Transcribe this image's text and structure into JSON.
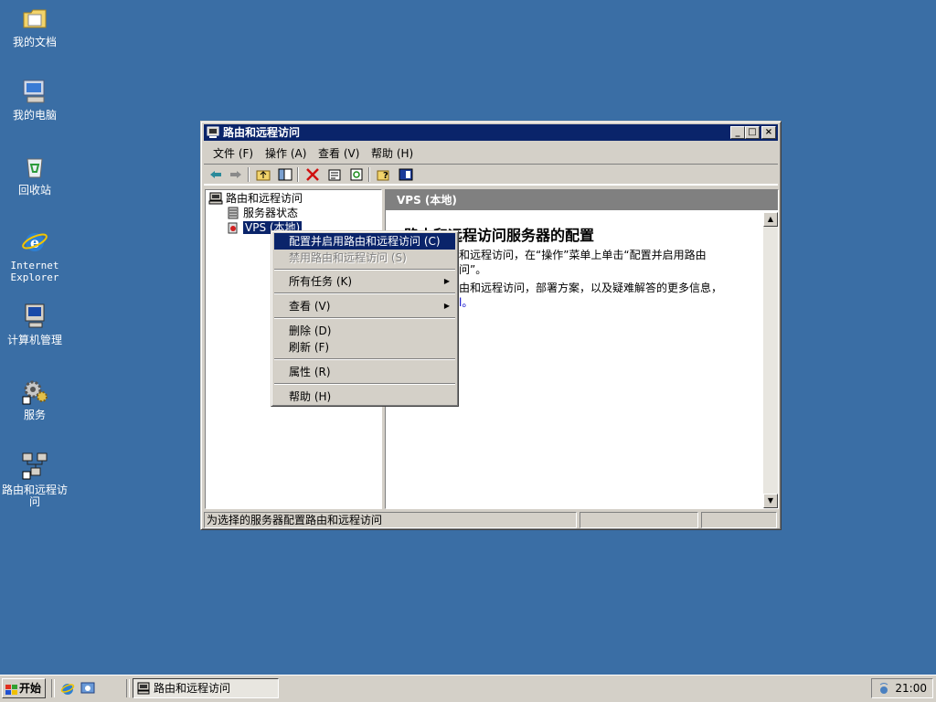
{
  "desktop": {
    "icons": [
      {
        "label": "我的文档"
      },
      {
        "label": "我的电脑"
      },
      {
        "label": "回收站"
      },
      {
        "label": "Internet Explorer"
      },
      {
        "label": "计算机管理"
      },
      {
        "label": "服务"
      },
      {
        "label": "路由和远程访问"
      }
    ]
  },
  "window": {
    "title": "路由和远程访问",
    "menu": [
      "文件 (F)",
      "操作 (A)",
      "查看 (V)",
      "帮助 (H)"
    ],
    "toolbar_icons": [
      "back-arrow-icon",
      "forward-arrow-icon",
      "up-folder-icon",
      "show-hide-tree-icon",
      "delete-icon",
      "properties-icon",
      "refresh-icon",
      "help-icon",
      "console-icon"
    ],
    "tree": {
      "root": "路由和远程访问",
      "server_status": "服务器状态",
      "server": "VPS (本地)"
    },
    "right": {
      "header": "VPS (本地)",
      "heading": "路由和远程访问服务器的配置",
      "line1": "和远程访问，在“操作”菜单上单击“配置并启用路由",
      "line1b": "问”。",
      "line2": "由和远程访问，部署方案，以及疑难解答的更多信息，",
      "line2b": "l。"
    },
    "status": "为选择的服务器配置路由和远程访问"
  },
  "context_menu": {
    "items": {
      "configure": "配置并启用路由和远程访问 (C)",
      "disable": "禁用路由和远程访问 (S)",
      "all_tasks": "所有任务 (K)",
      "view": "查看 (V)",
      "delete": "删除 (D)",
      "refresh": "刷新 (F)",
      "properties": "属性 (R)",
      "help": "帮助 (H)"
    }
  },
  "taskbar": {
    "start": "开始",
    "task": "路由和远程访问",
    "clock": "21:00"
  }
}
